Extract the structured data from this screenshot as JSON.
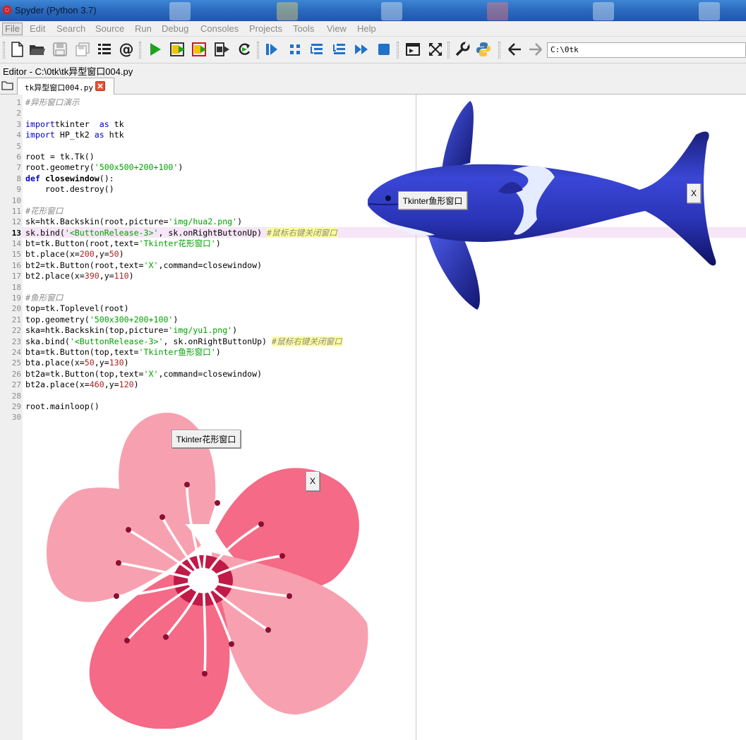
{
  "window": {
    "title": "Spyder (Python 3.7)"
  },
  "menu": [
    "File",
    "Edit",
    "Search",
    "Source",
    "Run",
    "Debug",
    "Consoles",
    "Projects",
    "Tools",
    "View",
    "Help"
  ],
  "toolbar": {
    "path_value": "C:\\0tk",
    "buttons": [
      "new-file",
      "open-file",
      "save-file",
      "save-all",
      "outline",
      "at-sign",
      "run",
      "run-cell",
      "run-cell-advance",
      "run-selection",
      "re-run",
      "debug",
      "step",
      "step-into",
      "step-return",
      "continue",
      "stop",
      "maximize-pane",
      "fullscreen",
      "preferences",
      "python-path",
      "back",
      "forward"
    ]
  },
  "editor": {
    "label": "Editor - C:\\0tk\\tk异型窗口004.py",
    "tab_label": "tk异型窗口004.py",
    "current_line": 13
  },
  "code": [
    [
      [
        "cmt",
        "#异形窗口演示"
      ]
    ],
    [],
    [
      [
        "kw",
        "import"
      ],
      [
        "",
        "tkinter  "
      ],
      [
        "kw",
        "as"
      ],
      [
        "",
        " tk"
      ]
    ],
    [
      [
        "kw",
        "import"
      ],
      [
        "",
        " HP_tk2 "
      ],
      [
        "kw",
        "as"
      ],
      [
        "",
        " htk"
      ]
    ],
    [],
    [
      [
        "",
        "root = tk.Tk()"
      ]
    ],
    [
      [
        "",
        "root.geometry("
      ],
      [
        "str",
        "'500x500+200+100'"
      ],
      [
        "",
        ")"
      ]
    ],
    [
      [
        "kwb",
        "def"
      ],
      [
        "",
        " "
      ],
      [
        "fn",
        "closewindow"
      ],
      [
        "",
        "():"
      ]
    ],
    [
      [
        "",
        "    root.destroy()"
      ]
    ],
    [],
    [
      [
        "cmt",
        "#花形窗口"
      ]
    ],
    [
      [
        "",
        "sk=htk.Backskin(root,picture="
      ],
      [
        "str",
        "'img/hua2.png'"
      ],
      [
        "",
        ")"
      ]
    ],
    [
      [
        "",
        "sk.bind("
      ],
      [
        "str",
        "'<ButtonRelease-3>'"
      ],
      [
        "",
        ", sk.onRightButtonUp) "
      ],
      [
        "cmt-hl",
        "#鼠标右键关闭窗口"
      ]
    ],
    [
      [
        "",
        "bt=tk.Button(root,text="
      ],
      [
        "str",
        "'Tkinter花形窗口'"
      ],
      [
        "",
        ")"
      ]
    ],
    [
      [
        "",
        "bt.place(x="
      ],
      [
        "num",
        "200"
      ],
      [
        "",
        ",y="
      ],
      [
        "num",
        "50"
      ],
      [
        "",
        ")"
      ]
    ],
    [
      [
        "",
        "bt2=tk.Button(root,text="
      ],
      [
        "str",
        "'X'"
      ],
      [
        "",
        ",command=closewindow)"
      ]
    ],
    [
      [
        "",
        "bt2.place(x="
      ],
      [
        "num",
        "390"
      ],
      [
        "",
        ",y="
      ],
      [
        "num",
        "110"
      ],
      [
        "",
        ")"
      ]
    ],
    [],
    [
      [
        "cmt",
        "#鱼形窗口"
      ]
    ],
    [
      [
        "",
        "top=tk.Toplevel(root)"
      ]
    ],
    [
      [
        "",
        "top.geometry("
      ],
      [
        "str",
        "'500x300+200+100'"
      ],
      [
        "",
        ")"
      ]
    ],
    [
      [
        "",
        "ska=htk.Backskin(top,picture="
      ],
      [
        "str",
        "'img/yu1.png'"
      ],
      [
        "",
        ")"
      ]
    ],
    [
      [
        "",
        "ska.bind("
      ],
      [
        "str",
        "'<ButtonRelease-3>'"
      ],
      [
        "",
        ", sk.onRightButtonUp) "
      ],
      [
        "cmt-hl",
        "#鼠标右键关闭窗口"
      ]
    ],
    [
      [
        "",
        "bta=tk.Button(top,text="
      ],
      [
        "str",
        "'Tkinter鱼形窗口'"
      ],
      [
        "",
        ")"
      ]
    ],
    [
      [
        "",
        "bta.place(x="
      ],
      [
        "num",
        "50"
      ],
      [
        "",
        ",y="
      ],
      [
        "num",
        "130"
      ],
      [
        "",
        ")"
      ]
    ],
    [
      [
        "",
        "bt2a=tk.Button(top,text="
      ],
      [
        "str",
        "'X'"
      ],
      [
        "",
        ",command=closewindow)"
      ]
    ],
    [
      [
        "",
        "bt2a.place(x="
      ],
      [
        "num",
        "460"
      ],
      [
        "",
        ",y="
      ],
      [
        "num",
        "120"
      ],
      [
        "",
        ")"
      ]
    ],
    [],
    [
      [
        "",
        "root.mainloop()"
      ]
    ],
    []
  ],
  "fish_window": {
    "button_label": "Tkinter鱼形窗口",
    "close_label": "X"
  },
  "flower_window": {
    "button_label": "Tkinter花形窗口",
    "close_label": "X"
  }
}
